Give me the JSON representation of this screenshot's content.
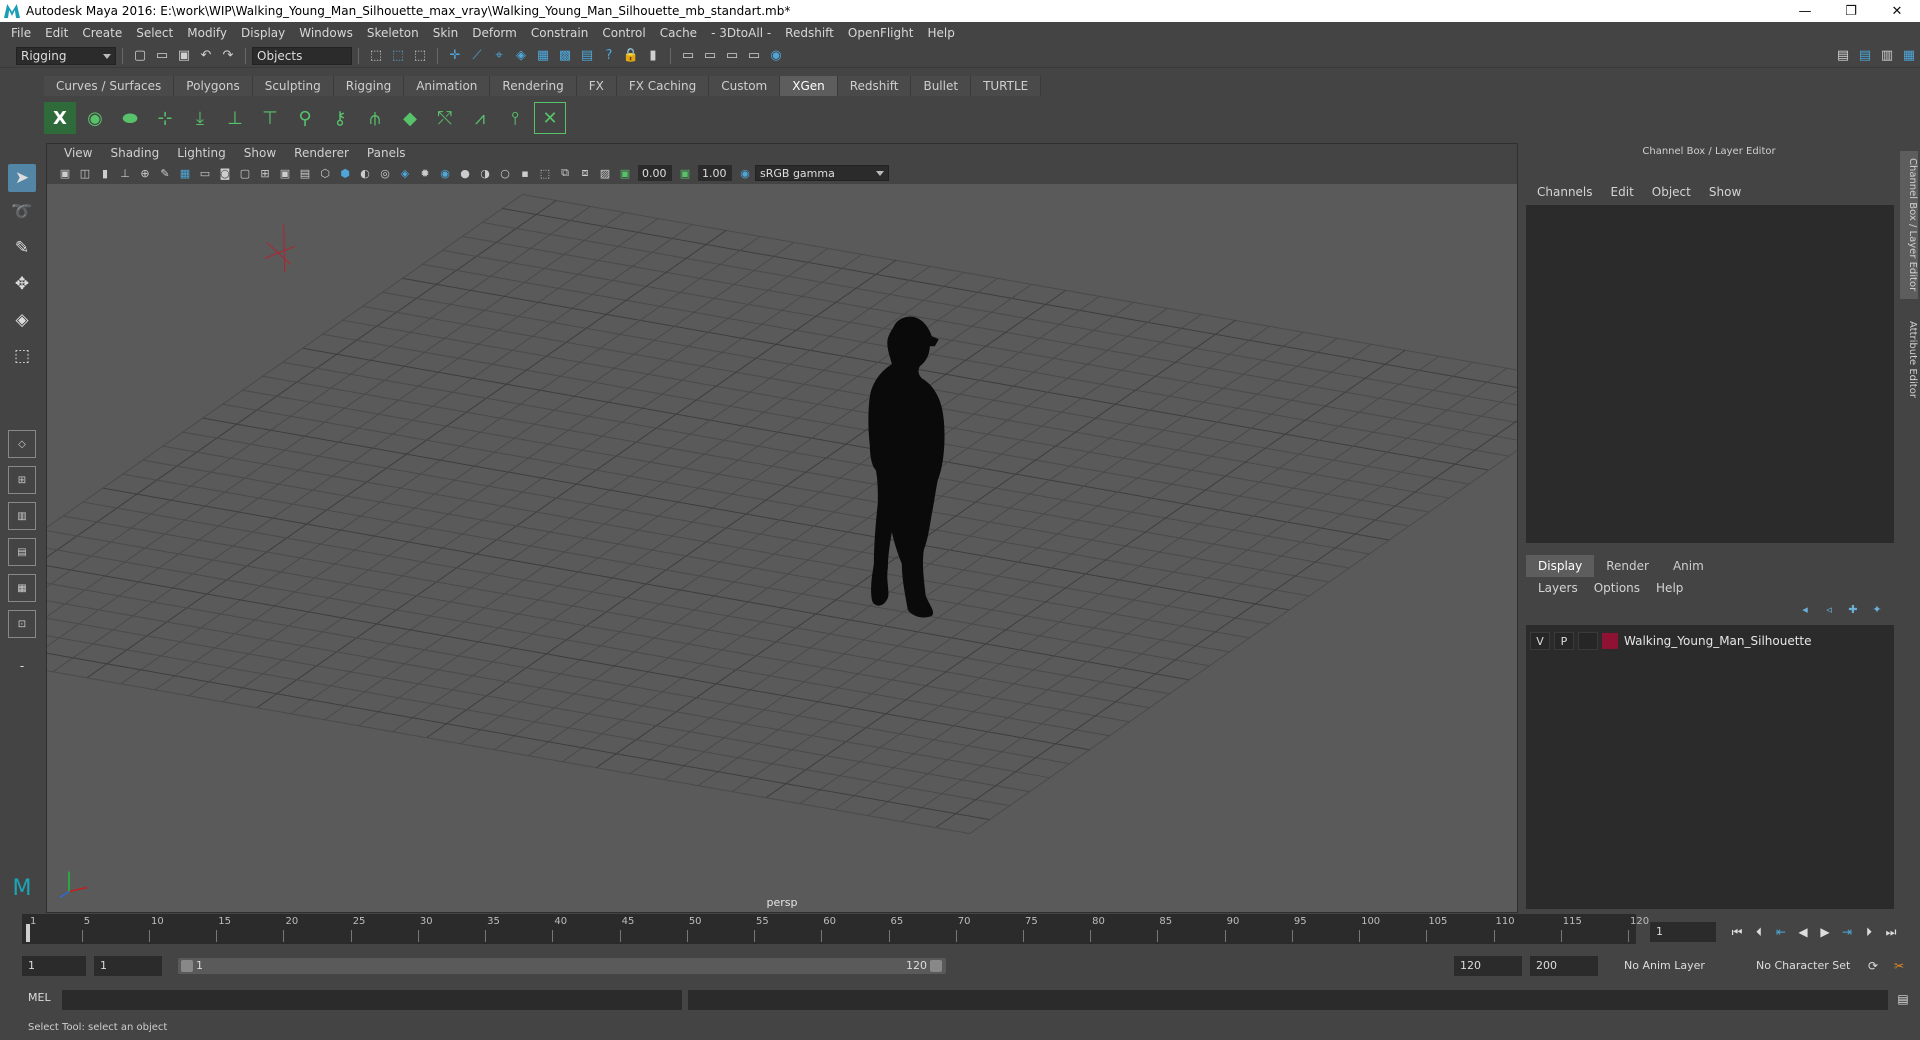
{
  "window": {
    "title": "Autodesk Maya 2016: E:\\work\\WIP\\Walking_Young_Man_Silhouette_max_vray\\Walking_Young_Man_Silhouette_mb_standart.mb*",
    "minimize": "—",
    "maximize": "❐",
    "close": "✕"
  },
  "menubar": [
    "File",
    "Edit",
    "Create",
    "Select",
    "Modify",
    "Display",
    "Windows",
    "Skeleton",
    "Skin",
    "Deform",
    "Constrain",
    "Control",
    "Cache",
    "- 3DtoAll -",
    "Redshift",
    "OpenFlight",
    "Help"
  ],
  "statusline": {
    "mode": "Rigging",
    "selection_mask": "Objects"
  },
  "shelf": {
    "tabs": [
      "Curves / Surfaces",
      "Polygons",
      "Sculpting",
      "Rigging",
      "Animation",
      "Rendering",
      "FX",
      "FX Caching",
      "Custom",
      "XGen",
      "Redshift",
      "Bullet",
      "TURTLE"
    ],
    "active_tab": "XGen"
  },
  "viewport": {
    "menus": [
      "View",
      "Shading",
      "Lighting",
      "Show",
      "Renderer",
      "Panels"
    ],
    "exposure": "0.00",
    "gamma": "1.00",
    "color_space": "sRGB gamma",
    "camera": "persp"
  },
  "channel_box": {
    "title": "Channel Box / Layer Editor",
    "menus": [
      "Channels",
      "Edit",
      "Object",
      "Show"
    ],
    "layer_tabs": [
      "Display",
      "Render",
      "Anim"
    ],
    "active_layer_tab": "Display",
    "layer_menus": [
      "Layers",
      "Options",
      "Help"
    ],
    "layers": [
      {
        "visible": "V",
        "playback": "P",
        "name": "Walking_Young_Man_Silhouette",
        "color": "#8f1234"
      }
    ]
  },
  "side_tabs": [
    "Channel Box / Layer Editor",
    "Attribute Editor"
  ],
  "timeline": {
    "ticks": [
      "1",
      "5",
      "10",
      "15",
      "20",
      "25",
      "30",
      "35",
      "40",
      "45",
      "50",
      "55",
      "60",
      "65",
      "70",
      "75",
      "80",
      "85",
      "90",
      "95",
      "100",
      "105",
      "110",
      "115",
      "120"
    ],
    "current_frame": "1"
  },
  "range": {
    "start": "1",
    "playback_start": "1",
    "slider_start": "1",
    "slider_end": "120",
    "playback_end": "120",
    "end": "200",
    "anim_layer": "No Anim Layer",
    "character_set": "No Character Set"
  },
  "command_line": {
    "language": "MEL"
  },
  "help_line": "Select Tool: select an object"
}
